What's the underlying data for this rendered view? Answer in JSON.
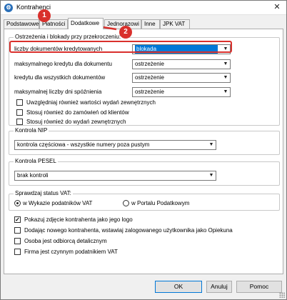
{
  "window": {
    "title": "Kontrahenci",
    "close_symbol": "✕"
  },
  "tabs": [
    {
      "label": "Podstawowe"
    },
    {
      "label": "Płatności"
    },
    {
      "label": "Dodatkowe"
    },
    {
      "label": "Jednorazowi"
    },
    {
      "label": "Inne"
    },
    {
      "label": "JPK VAT"
    }
  ],
  "overlays": {
    "badge1": "1",
    "badge2": "2"
  },
  "warnings": {
    "legend": "Ostrzeżenia i blokady przy przekroczeniu:",
    "rows": [
      {
        "label": "liczby dokumentów kredytowanych",
        "value": "blokada"
      },
      {
        "label": "maksymalnego kredytu dla  dokumentu",
        "value": "ostrzeżenie"
      },
      {
        "label": "kredytu dla wszystkich dokumentów",
        "value": "ostrzeżenie"
      },
      {
        "label": "maksymalnej liczby dni spóźnienia",
        "value": "ostrzeżenie"
      }
    ],
    "checks": [
      {
        "label": "Uwzględniaj również wartości wydań zewnętrznych",
        "checked": false
      },
      {
        "label": "Stosuj również do zamówień od klientów",
        "checked": false
      },
      {
        "label": "Stosuj również do wydań zewnętrznych",
        "checked": false
      }
    ]
  },
  "nip": {
    "legend": "Kontrola NIP",
    "value": "kontrola częściowa - wszystkie numery poza pustym"
  },
  "pesel": {
    "legend": "Kontrola PESEL",
    "value": "brak kontroli"
  },
  "vat": {
    "legend": "Sprawdzaj status VAT:",
    "radios": [
      {
        "label": "w Wykazie podatników VAT",
        "selected": true
      },
      {
        "label": "w Portalu Podatkowym",
        "selected": false
      }
    ]
  },
  "options": [
    {
      "label": "Pokazuj zdjęcie kontrahenta jako jego logo",
      "checked": true
    },
    {
      "label": "Dodając nowego kontrahenta, wstawiaj zalogowanego użytkownika jako Opiekuna",
      "checked": false
    },
    {
      "label": "Osoba jest odbiorcą detalicznym",
      "checked": false
    },
    {
      "label": "Firma jest czynnym podatnikiem VAT",
      "checked": false
    }
  ],
  "buttons": {
    "ok": "OK",
    "cancel": "Anuluj",
    "help": "Pomoc"
  },
  "colors": {
    "highlight": "#d9302c",
    "selection": "#0078d7"
  }
}
